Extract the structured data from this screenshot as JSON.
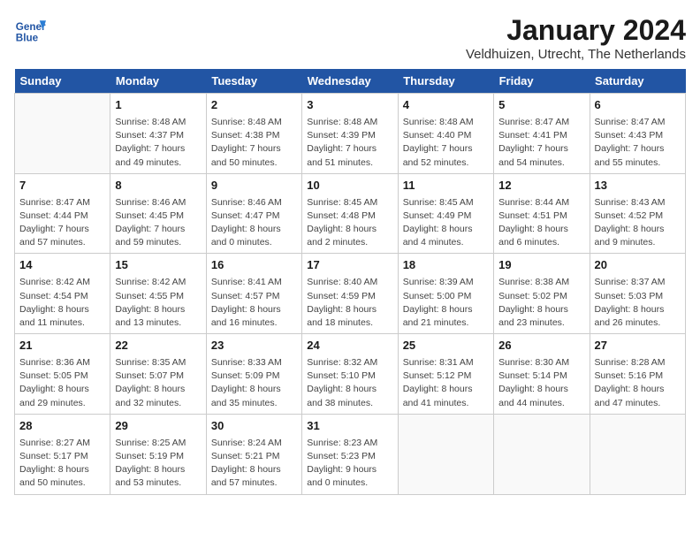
{
  "header": {
    "logo_line1": "General",
    "logo_line2": "Blue",
    "title": "January 2024",
    "subtitle": "Veldhuizen, Utrecht, The Netherlands"
  },
  "days_of_week": [
    "Sunday",
    "Monday",
    "Tuesday",
    "Wednesday",
    "Thursday",
    "Friday",
    "Saturday"
  ],
  "weeks": [
    [
      {
        "num": "",
        "sunrise": "",
        "sunset": "",
        "daylight": ""
      },
      {
        "num": "1",
        "sunrise": "Sunrise: 8:48 AM",
        "sunset": "Sunset: 4:37 PM",
        "daylight": "Daylight: 7 hours and 49 minutes."
      },
      {
        "num": "2",
        "sunrise": "Sunrise: 8:48 AM",
        "sunset": "Sunset: 4:38 PM",
        "daylight": "Daylight: 7 hours and 50 minutes."
      },
      {
        "num": "3",
        "sunrise": "Sunrise: 8:48 AM",
        "sunset": "Sunset: 4:39 PM",
        "daylight": "Daylight: 7 hours and 51 minutes."
      },
      {
        "num": "4",
        "sunrise": "Sunrise: 8:48 AM",
        "sunset": "Sunset: 4:40 PM",
        "daylight": "Daylight: 7 hours and 52 minutes."
      },
      {
        "num": "5",
        "sunrise": "Sunrise: 8:47 AM",
        "sunset": "Sunset: 4:41 PM",
        "daylight": "Daylight: 7 hours and 54 minutes."
      },
      {
        "num": "6",
        "sunrise": "Sunrise: 8:47 AM",
        "sunset": "Sunset: 4:43 PM",
        "daylight": "Daylight: 7 hours and 55 minutes."
      }
    ],
    [
      {
        "num": "7",
        "sunrise": "Sunrise: 8:47 AM",
        "sunset": "Sunset: 4:44 PM",
        "daylight": "Daylight: 7 hours and 57 minutes."
      },
      {
        "num": "8",
        "sunrise": "Sunrise: 8:46 AM",
        "sunset": "Sunset: 4:45 PM",
        "daylight": "Daylight: 7 hours and 59 minutes."
      },
      {
        "num": "9",
        "sunrise": "Sunrise: 8:46 AM",
        "sunset": "Sunset: 4:47 PM",
        "daylight": "Daylight: 8 hours and 0 minutes."
      },
      {
        "num": "10",
        "sunrise": "Sunrise: 8:45 AM",
        "sunset": "Sunset: 4:48 PM",
        "daylight": "Daylight: 8 hours and 2 minutes."
      },
      {
        "num": "11",
        "sunrise": "Sunrise: 8:45 AM",
        "sunset": "Sunset: 4:49 PM",
        "daylight": "Daylight: 8 hours and 4 minutes."
      },
      {
        "num": "12",
        "sunrise": "Sunrise: 8:44 AM",
        "sunset": "Sunset: 4:51 PM",
        "daylight": "Daylight: 8 hours and 6 minutes."
      },
      {
        "num": "13",
        "sunrise": "Sunrise: 8:43 AM",
        "sunset": "Sunset: 4:52 PM",
        "daylight": "Daylight: 8 hours and 9 minutes."
      }
    ],
    [
      {
        "num": "14",
        "sunrise": "Sunrise: 8:42 AM",
        "sunset": "Sunset: 4:54 PM",
        "daylight": "Daylight: 8 hours and 11 minutes."
      },
      {
        "num": "15",
        "sunrise": "Sunrise: 8:42 AM",
        "sunset": "Sunset: 4:55 PM",
        "daylight": "Daylight: 8 hours and 13 minutes."
      },
      {
        "num": "16",
        "sunrise": "Sunrise: 8:41 AM",
        "sunset": "Sunset: 4:57 PM",
        "daylight": "Daylight: 8 hours and 16 minutes."
      },
      {
        "num": "17",
        "sunrise": "Sunrise: 8:40 AM",
        "sunset": "Sunset: 4:59 PM",
        "daylight": "Daylight: 8 hours and 18 minutes."
      },
      {
        "num": "18",
        "sunrise": "Sunrise: 8:39 AM",
        "sunset": "Sunset: 5:00 PM",
        "daylight": "Daylight: 8 hours and 21 minutes."
      },
      {
        "num": "19",
        "sunrise": "Sunrise: 8:38 AM",
        "sunset": "Sunset: 5:02 PM",
        "daylight": "Daylight: 8 hours and 23 minutes."
      },
      {
        "num": "20",
        "sunrise": "Sunrise: 8:37 AM",
        "sunset": "Sunset: 5:03 PM",
        "daylight": "Daylight: 8 hours and 26 minutes."
      }
    ],
    [
      {
        "num": "21",
        "sunrise": "Sunrise: 8:36 AM",
        "sunset": "Sunset: 5:05 PM",
        "daylight": "Daylight: 8 hours and 29 minutes."
      },
      {
        "num": "22",
        "sunrise": "Sunrise: 8:35 AM",
        "sunset": "Sunset: 5:07 PM",
        "daylight": "Daylight: 8 hours and 32 minutes."
      },
      {
        "num": "23",
        "sunrise": "Sunrise: 8:33 AM",
        "sunset": "Sunset: 5:09 PM",
        "daylight": "Daylight: 8 hours and 35 minutes."
      },
      {
        "num": "24",
        "sunrise": "Sunrise: 8:32 AM",
        "sunset": "Sunset: 5:10 PM",
        "daylight": "Daylight: 8 hours and 38 minutes."
      },
      {
        "num": "25",
        "sunrise": "Sunrise: 8:31 AM",
        "sunset": "Sunset: 5:12 PM",
        "daylight": "Daylight: 8 hours and 41 minutes."
      },
      {
        "num": "26",
        "sunrise": "Sunrise: 8:30 AM",
        "sunset": "Sunset: 5:14 PM",
        "daylight": "Daylight: 8 hours and 44 minutes."
      },
      {
        "num": "27",
        "sunrise": "Sunrise: 8:28 AM",
        "sunset": "Sunset: 5:16 PM",
        "daylight": "Daylight: 8 hours and 47 minutes."
      }
    ],
    [
      {
        "num": "28",
        "sunrise": "Sunrise: 8:27 AM",
        "sunset": "Sunset: 5:17 PM",
        "daylight": "Daylight: 8 hours and 50 minutes."
      },
      {
        "num": "29",
        "sunrise": "Sunrise: 8:25 AM",
        "sunset": "Sunset: 5:19 PM",
        "daylight": "Daylight: 8 hours and 53 minutes."
      },
      {
        "num": "30",
        "sunrise": "Sunrise: 8:24 AM",
        "sunset": "Sunset: 5:21 PM",
        "daylight": "Daylight: 8 hours and 57 minutes."
      },
      {
        "num": "31",
        "sunrise": "Sunrise: 8:23 AM",
        "sunset": "Sunset: 5:23 PM",
        "daylight": "Daylight: 9 hours and 0 minutes."
      },
      {
        "num": "",
        "sunrise": "",
        "sunset": "",
        "daylight": ""
      },
      {
        "num": "",
        "sunrise": "",
        "sunset": "",
        "daylight": ""
      },
      {
        "num": "",
        "sunrise": "",
        "sunset": "",
        "daylight": ""
      }
    ]
  ]
}
